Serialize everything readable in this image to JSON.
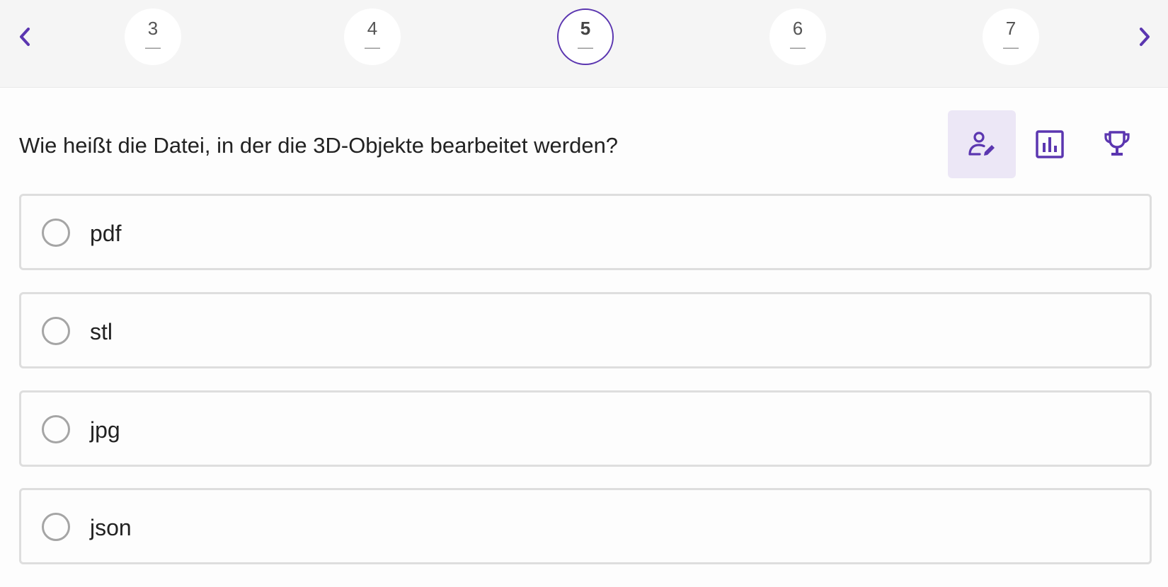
{
  "pager": {
    "steps": [
      {
        "number": "3",
        "status": "—"
      },
      {
        "number": "4",
        "status": "—"
      },
      {
        "number": "5",
        "status": "—"
      },
      {
        "number": "6",
        "status": "—"
      },
      {
        "number": "7",
        "status": "—"
      }
    ],
    "active_step": "5",
    "prev_icon": "chevron-left-icon",
    "next_icon": "chevron-right-icon"
  },
  "question": {
    "text": "Wie heißt die Datei, in der die 3D-Objekte bearbeitet werden?"
  },
  "toolbar": {
    "items": [
      {
        "icon": "person-edit-icon",
        "selected": true
      },
      {
        "icon": "bar-chart-icon",
        "selected": false
      },
      {
        "icon": "trophy-icon",
        "selected": false
      }
    ]
  },
  "options": [
    {
      "label": "pdf"
    },
    {
      "label": "stl"
    },
    {
      "label": "jpg"
    },
    {
      "label": "json"
    }
  ],
  "colors": {
    "accent": "#5b36b0",
    "selected_tool_bg": "#ece7f6",
    "topbar_bg": "#f5f5f5",
    "option_border": "#dedede",
    "radio_border": "#a5a5a5"
  }
}
